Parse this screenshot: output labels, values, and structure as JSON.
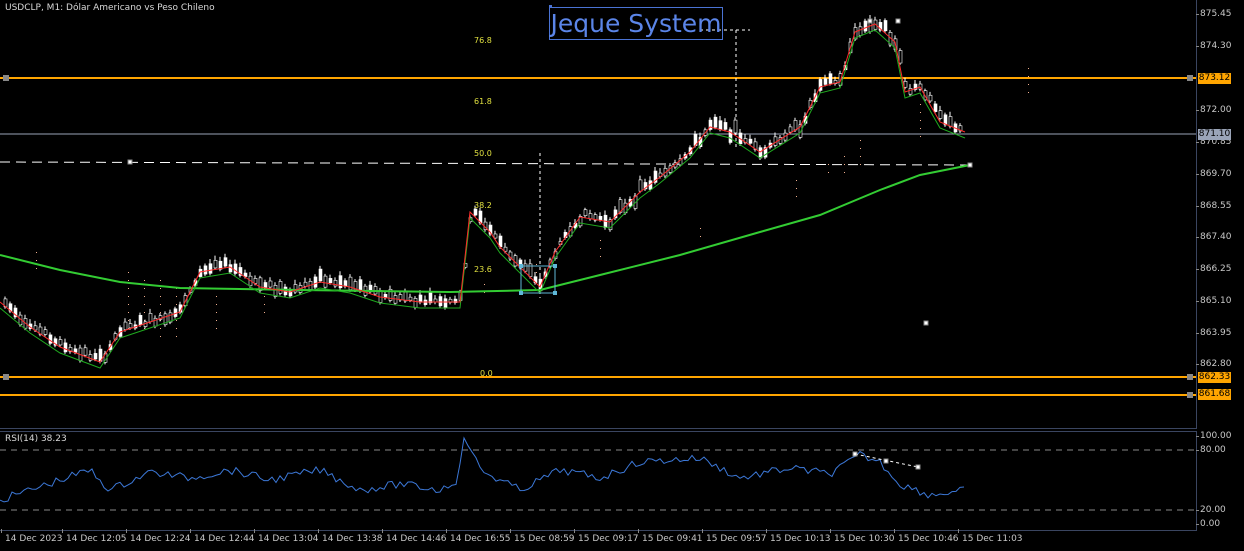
{
  "chart_header": {
    "symbol_text": "USDCLP, M1:  Dólar Americano vs Peso Chileno"
  },
  "watermark_text": "Jeque System",
  "price_axis": {
    "labels": [
      "875.45",
      "874.30",
      "872.00",
      "870.85",
      "869.70",
      "868.55",
      "867.40",
      "866.25",
      "865.10",
      "863.95",
      "862.80"
    ],
    "tags": {
      "resistance": "873.12",
      "current": "871.10",
      "support_1": "862.33",
      "support_2": "861.68"
    },
    "colors": {
      "levels": "#ffa500",
      "current_tag": "#9aa4b8",
      "grid": "#3a4560"
    }
  },
  "fibonacci": {
    "levels": [
      "76.8",
      "61.8",
      "50.0",
      "38.2",
      "23.6",
      "0.0"
    ],
    "color": "#e0e040"
  },
  "rsi": {
    "header": "RSI(14) 38.23",
    "axis_labels": [
      "100.00",
      "80.00",
      "20.00",
      "0.00"
    ],
    "line_color": "#3c78d8"
  },
  "time_axis": {
    "labels": [
      "14 Dec 2023",
      "14 Dec 12:05",
      "14 Dec 12:24",
      "14 Dec 12:44",
      "14 Dec 13:04",
      "14 Dec 13:38",
      "14 Dec 14:46",
      "14 Dec 16:55",
      "15 Dec 08:59",
      "15 Dec 09:17",
      "15 Dec 09:41",
      "15 Dec 09:57",
      "15 Dec 10:13",
      "15 Dec 10:30",
      "15 Dec 10:46",
      "15 Dec 11:03"
    ]
  },
  "indicators": {
    "ma_slow_color": "#33cc33",
    "ma_fast_color": "#ff2a2a",
    "ma_mid_color": "#1faa1f",
    "cloud_color": "#f0b090",
    "candle_color": "#ffffff"
  }
}
